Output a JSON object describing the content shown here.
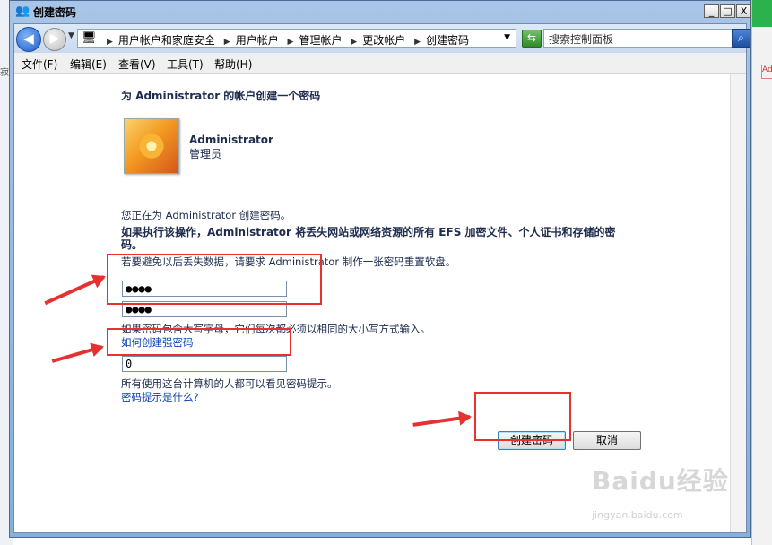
{
  "window": {
    "title": "创建密码",
    "controls": [
      "_",
      "□",
      "X"
    ]
  },
  "background": {
    "left_fragment": "寂"
  },
  "address_bar": {
    "breadcrumbs": [
      "用户帐户和家庭安全",
      "用户帐户",
      "管理帐户",
      "更改帐户",
      "创建密码"
    ],
    "search_placeholder": "搜索控制面板"
  },
  "menu": [
    "文件(F)",
    "编辑(E)",
    "查看(V)",
    "工具(T)",
    "帮助(H)"
  ],
  "content": {
    "heading": "为 Administrator 的帐户创建一个密码",
    "user": {
      "name": "Administrator",
      "role": "管理员"
    },
    "info_line": "您正在为 Administrator 创建密码。",
    "warning": "如果执行该操作，Administrator 将丢失网站或网络资源的所有 EFS 加密文件、个人证书和存储的密码。",
    "reset_tip": "若要避免以后丢失数据，请要求 Administrator 制作一张密码重置软盘。",
    "password_value": "●●●●",
    "confirm_value": "●●●●",
    "case_note": "如果密码包含大写字母，它们每次都必须以相同的大小写方式输入。",
    "strong_link": "如何创建强密码",
    "hint_value": "0",
    "hint_note": "所有使用这台计算机的人都可以看见密码提示。",
    "hint_link": "密码提示是什么?",
    "create_button": "创建密码",
    "cancel_button": "取消"
  },
  "watermark": {
    "logo": "Baidu经验",
    "url": "jingyan.baidu.com"
  },
  "colors": {
    "annotation": "#e63131",
    "link": "#0b40b5",
    "text": "#1e2d4f"
  }
}
